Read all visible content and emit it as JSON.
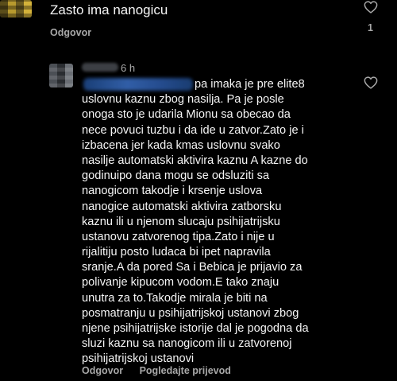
{
  "comment": {
    "text": "Zasto ima nanogicu",
    "reply_label": "Odgovor",
    "like_count": "1"
  },
  "reply": {
    "time": "6 h",
    "lines": [
      "pa imaka je pre elite8",
      "uslovnu kaznu zbog nasilja. Pa je posle",
      "onoga sto je udarila Mionu sa obecao da",
      "nece povuci tuzbu i da ide u zatvor.Zato je i",
      "izbacena jer kada kmas uslovnu svako",
      "nasilje automatski aktivira kaznu  A kazne do",
      "godinuipo dana mogu se odsluziti sa",
      "nanogicom takodje i krsenje uslova",
      "nanogice automatski aktivira zatborsku",
      "kaznu ili u njenom slucaju psihijatrijsku",
      "ustanovu zatvorenog tipa.Zato i nije u",
      "rijalitiju posto ludaca bi ipet napravila",
      "sranje.A da pored Sa i Bebica je prijavio za",
      "polivanje kipucom vodom.E tako znaju",
      "unutra za to.Takodje mirala je biti na",
      "posmatranju u psihijatrijskoj ustanovi zbog",
      "njene psihijatrijske istorije dal je pogodna da",
      "sluzi kaznu sa nanogicom ili u zatvorenoj",
      "psihijatrijskoj ustanovi"
    ],
    "reply_label": "Odgovor",
    "translate_label": "Pogledajte prijevod"
  },
  "icons": {
    "like": "heart-outline-icon"
  },
  "colors": {
    "background": "#000000",
    "text": "#f5f5f5",
    "muted": "#a8a8a8"
  }
}
